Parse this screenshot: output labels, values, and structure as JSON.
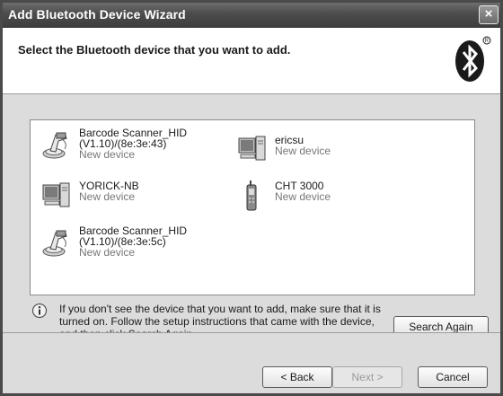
{
  "window": {
    "title": "Add Bluetooth Device Wizard",
    "close_label": "×"
  },
  "header": {
    "title": "Select the Bluetooth device that you want to add."
  },
  "devices": [
    {
      "name_line1": "Barcode Scanner_HID",
      "name_line2": "(V1.10)/(8e:3e:43)",
      "status": "New device",
      "icon": "barcode-scanner-icon"
    },
    {
      "name_line1": "ericsu",
      "status": "New device",
      "icon": "computer-icon"
    },
    {
      "name_line1": "YORICK-NB",
      "status": "New device",
      "icon": "computer-icon"
    },
    {
      "name_line1": "CHT 3000",
      "status": "New device",
      "icon": "phone-icon"
    },
    {
      "name_line1": "Barcode Scanner_HID",
      "name_line2": "(V1.10)/(8e:3e:5c)",
      "status": "New device",
      "icon": "barcode-scanner-icon"
    }
  ],
  "info": {
    "line1": "If you don't see the device that you want to add, make sure that it is",
    "line2": "turned on. Follow the setup instructions that came with the device,",
    "line3": "and then click Search Again."
  },
  "buttons": {
    "search_again": "Search Again",
    "back": "< Back",
    "next": "Next >",
    "cancel": "Cancel"
  }
}
